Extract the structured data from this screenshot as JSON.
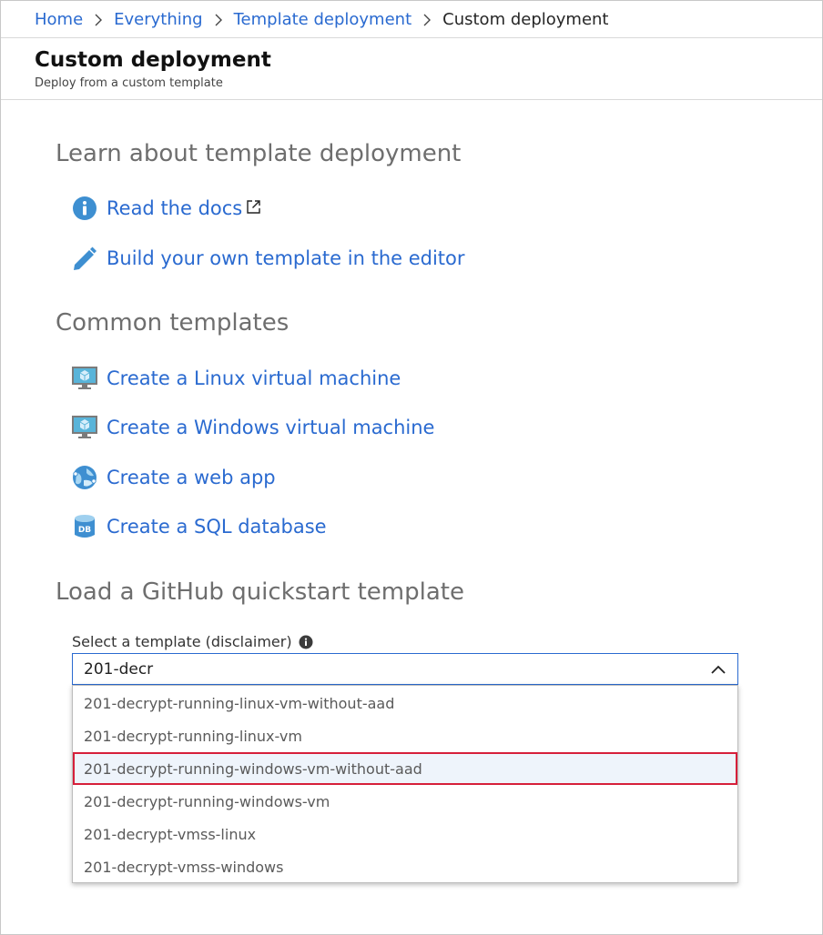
{
  "breadcrumb": {
    "items": [
      "Home",
      "Everything",
      "Template deployment"
    ],
    "current": "Custom deployment"
  },
  "header": {
    "title": "Custom deployment",
    "subtitle": "Deploy from a custom template"
  },
  "learn": {
    "heading": "Learn about template deployment",
    "links": [
      {
        "label": "Read the docs",
        "icon": "info-icon",
        "external": true
      },
      {
        "label": "Build your own template in the editor",
        "icon": "pencil-icon"
      }
    ]
  },
  "common": {
    "heading": "Common templates",
    "links": [
      {
        "label": "Create a Linux virtual machine",
        "icon": "virtual-machine-icon"
      },
      {
        "label": "Create a Windows virtual machine",
        "icon": "virtual-machine-icon"
      },
      {
        "label": "Create a web app",
        "icon": "web-app-icon"
      },
      {
        "label": "Create a SQL database",
        "icon": "sql-database-icon"
      }
    ]
  },
  "github": {
    "heading": "Load a GitHub quickstart template",
    "field_label": "Select a template (disclaimer)",
    "input_value": "201-decr",
    "options": [
      "201-decrypt-running-linux-vm-without-aad",
      "201-decrypt-running-linux-vm",
      "201-decrypt-running-windows-vm-without-aad",
      "201-decrypt-running-windows-vm",
      "201-decrypt-vmss-linux",
      "201-decrypt-vmss-windows"
    ],
    "highlighted_index": 2
  },
  "colors": {
    "link": "#2a6ad0",
    "heading": "#6e6e6e",
    "highlight_border": "#d61f3a",
    "highlight_bg": "#eef4fb"
  }
}
